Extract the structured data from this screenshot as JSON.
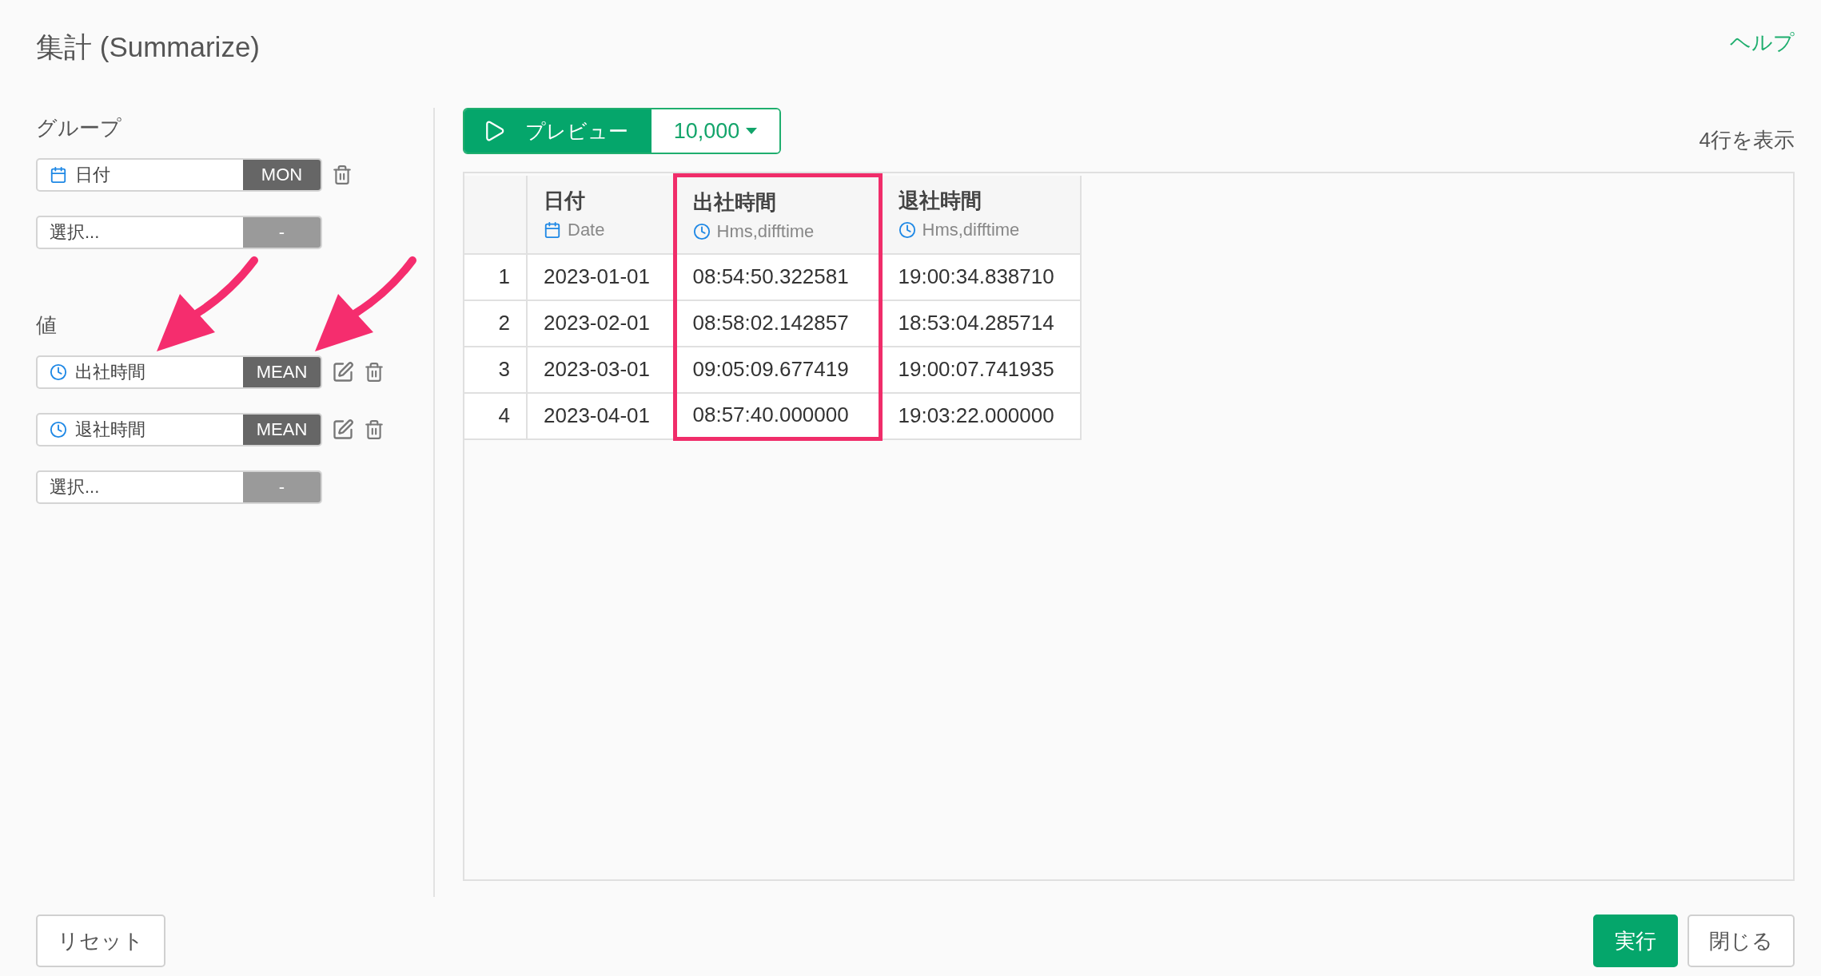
{
  "title": "集計 (Summarize)",
  "help_link": "ヘルプ",
  "group": {
    "label": "グループ",
    "items": [
      {
        "kind": "date",
        "name": "日付",
        "function": "MON"
      },
      {
        "kind": "empty",
        "placeholder": "選択...",
        "function": "-"
      }
    ]
  },
  "values": {
    "label": "値",
    "items": [
      {
        "kind": "time",
        "name": "出社時間",
        "function": "MEAN"
      },
      {
        "kind": "time",
        "name": "退社時間",
        "function": "MEAN"
      },
      {
        "kind": "empty",
        "placeholder": "選択...",
        "function": "-"
      }
    ]
  },
  "preview": {
    "label": "プレビュー",
    "row_limit": "10,000"
  },
  "row_count": "4行を表示",
  "table": {
    "columns": [
      {
        "kind": "index",
        "highlighted": false
      },
      {
        "name": "日付",
        "type": "Date",
        "kind": "date",
        "highlighted": false
      },
      {
        "name": "出社時間",
        "type": "Hms,difftime",
        "kind": "time",
        "highlighted": true
      },
      {
        "name": "退社時間",
        "type": "Hms,difftime",
        "kind": "time",
        "highlighted": false
      }
    ],
    "rows": [
      [
        "1",
        "2023-01-01",
        "08:54:50.322581",
        "19:00:34.838710"
      ],
      [
        "2",
        "2023-02-01",
        "08:58:02.142857",
        "18:53:04.285714"
      ],
      [
        "3",
        "2023-03-01",
        "09:05:09.677419",
        "19:00:07.741935"
      ],
      [
        "4",
        "2023-04-01",
        "08:57:40.000000",
        "19:03:22.000000"
      ]
    ]
  },
  "footer": {
    "reset": "リセット",
    "run": "実行",
    "close": "閉じる"
  }
}
